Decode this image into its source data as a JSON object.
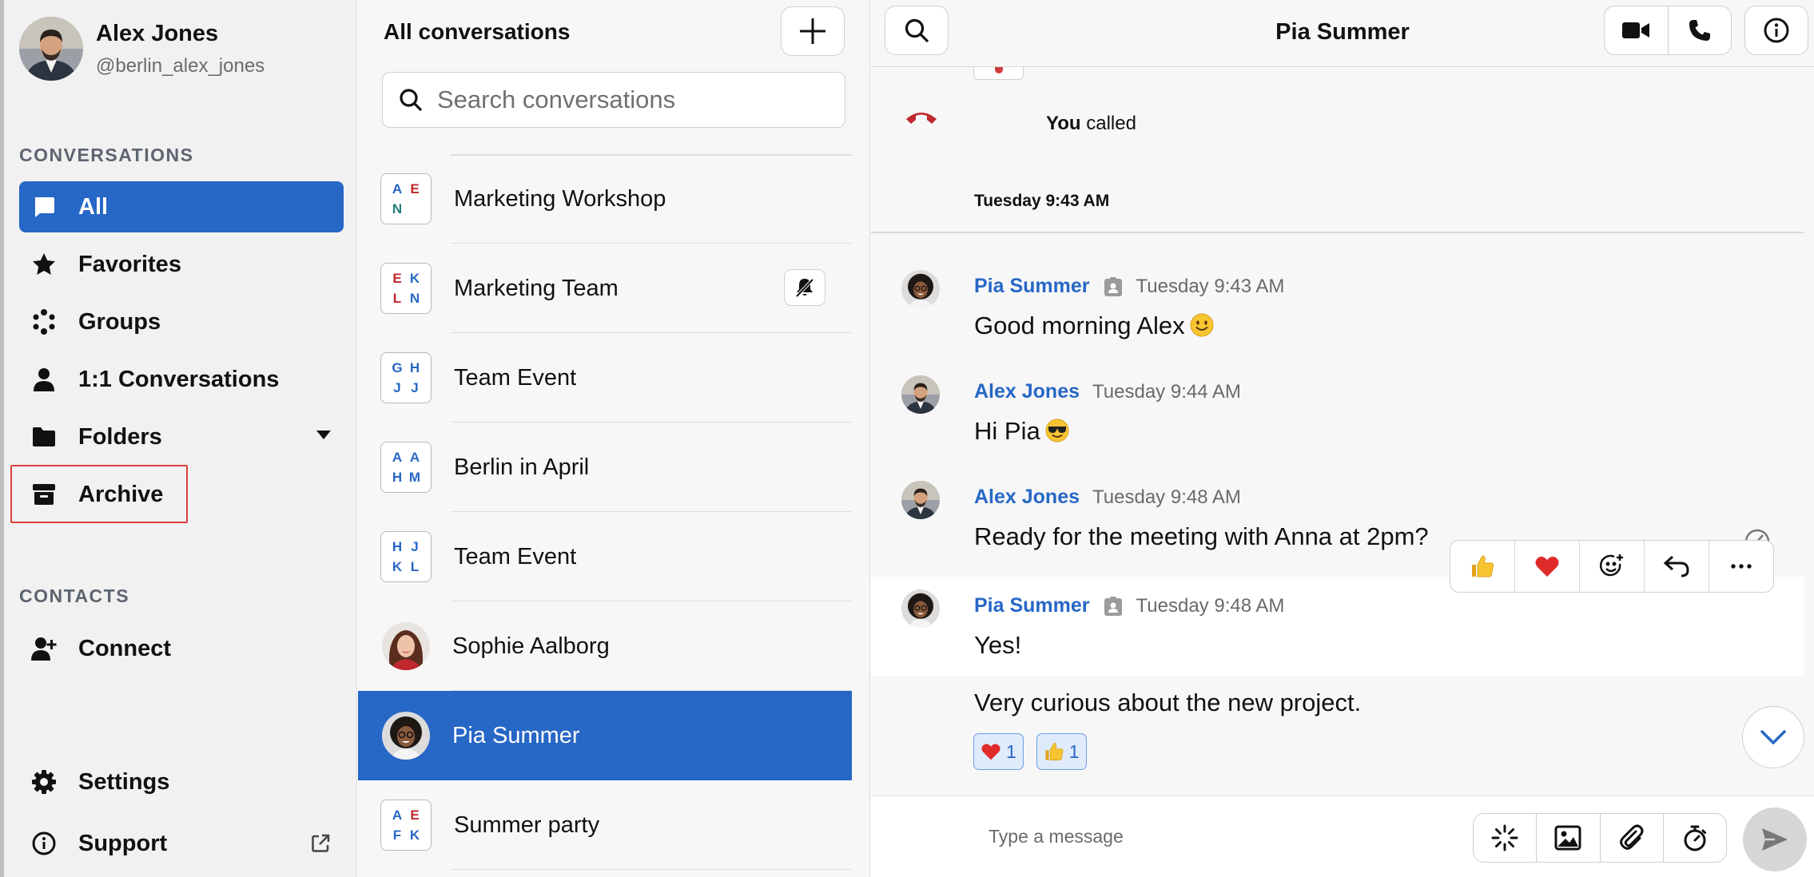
{
  "user": {
    "name": "Alex Jones",
    "handle": "@berlin_alex_jones"
  },
  "sidebar": {
    "conversations_title": "CONVERSATIONS",
    "items": [
      {
        "label": "All",
        "icon": "chat-bubble-icon"
      },
      {
        "label": "Favorites",
        "icon": "star-icon"
      },
      {
        "label": "Groups",
        "icon": "groups-icon"
      },
      {
        "label": "1:1 Conversations",
        "icon": "person-icon"
      },
      {
        "label": "Folders",
        "icon": "folder-icon"
      },
      {
        "label": "Archive",
        "icon": "archive-icon"
      }
    ],
    "contacts_title": "CONTACTS",
    "connect_label": "Connect",
    "settings_label": "Settings",
    "support_label": "Support"
  },
  "conversation_list": {
    "title": "All conversations",
    "search_placeholder": "Search conversations",
    "items": [
      {
        "name": "Marketing Workshop",
        "initials": [
          "A",
          "E",
          "N",
          ""
        ]
      },
      {
        "name": "Marketing Team",
        "initials": [
          "E",
          "K",
          "L",
          "N"
        ],
        "muted": true
      },
      {
        "name": "Team Event",
        "initials": [
          "G",
          "H",
          "J",
          "J"
        ]
      },
      {
        "name": "Berlin in April",
        "initials": [
          "A",
          "A",
          "H",
          "M"
        ]
      },
      {
        "name": "Team Event",
        "initials": [
          "H",
          "J",
          "K",
          "L"
        ]
      },
      {
        "name": "Sophie Aalborg"
      },
      {
        "name": "Pia Summer",
        "selected": true
      },
      {
        "name": "Summer party",
        "initials": [
          "A",
          "E",
          "F",
          "K"
        ]
      }
    ]
  },
  "chat": {
    "title": "Pia Summer",
    "call": {
      "actor": "You",
      "text": "called"
    },
    "date_separator": "Tuesday 9:43 AM",
    "messages": [
      {
        "author": "Pia Summer",
        "time": "Tuesday 9:43 AM",
        "text": "Good morning Alex"
      },
      {
        "author": "Alex Jones",
        "time": "Tuesday 9:44 AM",
        "text": "Hi Pia"
      },
      {
        "author": "Alex Jones",
        "time": "Tuesday 9:48 AM",
        "text": "Ready for the meeting with Anna at 2pm?"
      },
      {
        "author": "Pia Summer",
        "time": "Tuesday 9:48 AM",
        "text": "Yes!"
      }
    ],
    "followup_text": "Very curious about the new project.",
    "reactions": [
      {
        "emoji": "heart",
        "count": "1"
      },
      {
        "emoji": "thumbs-up",
        "count": "1"
      }
    ],
    "composer_placeholder": "Type a message"
  },
  "colors": {
    "accent": "#2767c6",
    "sidebar_bg": "#f1f1f2",
    "list_bg": "#f7f7f8",
    "highlight_border": "#d9413a",
    "reaction_chip_bg": "#dfeafb",
    "initial_blue": "#2767c6",
    "initial_red": "#c0282d",
    "initial_teal": "#237b7b"
  }
}
